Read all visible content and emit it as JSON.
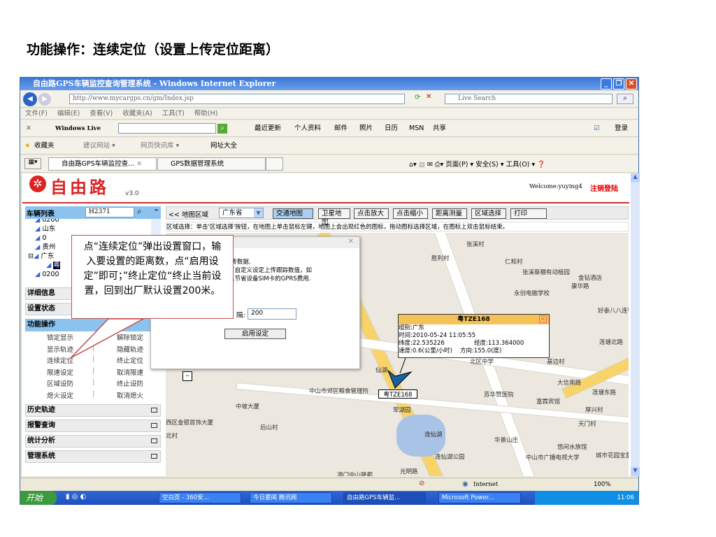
{
  "slide": {
    "title": "功能操作：连续定位（设置上传定位距离）"
  },
  "window": {
    "title": "自由路GPS车辆监控查询管理系统 - Windows Internet Explorer",
    "url": "http://www.mycargps.cn/gm/Index.jsp",
    "search_placeholder": "Live Search"
  },
  "menu": [
    "文件(F)",
    "编辑(E)",
    "查看(V)",
    "收藏夹(A)",
    "工具(T)",
    "帮助(H)"
  ],
  "live_toolbar": {
    "brand": "Windows Live",
    "links": [
      "最近更新",
      "个人资料",
      "邮件",
      "照片",
      "日历",
      "MSN",
      "共享"
    ],
    "signin": "登录"
  },
  "favorites": {
    "label": "收藏夹",
    "items": [
      "建议网站 ▾",
      "网页快讯库 ▾",
      "网址大全"
    ]
  },
  "tabs": [
    {
      "label": "自由路GPS车辆监控查..."
    },
    {
      "label": "GPS数据管理系统"
    }
  ],
  "command_bar": [
    "页面(P) ▾",
    "安全(S) ▾",
    "工具(O) ▾"
  ],
  "page": {
    "logo": "自由路",
    "version": "v3.0",
    "welcome": "Welcome:yuying4",
    "logout": "注销登陆"
  },
  "sidebar": {
    "vehicle_list": "车辆列表",
    "search_value": "H2371",
    "tree": [
      "0200",
      "山东",
      "0",
      "贵州",
      "广东",
      "粤",
      "0200"
    ],
    "sections": [
      "详细信息",
      "设置状态",
      "功能操作"
    ],
    "functions": [
      [
        "锁定显示",
        "解除锁定"
      ],
      [
        "显示轨迹",
        "隐藏轨迹"
      ],
      [
        "连续定位",
        "终止定位"
      ],
      [
        "限速设定",
        "取消限速"
      ],
      [
        "区域设防",
        "终止设防"
      ],
      [
        "熄火设定",
        "取消熄火"
      ]
    ],
    "collapsed": [
      "历史轨迹",
      "报警查询",
      "统计分析",
      "管理系统"
    ]
  },
  "map_toolbar": {
    "region_label": "<< 地图区域",
    "province": "广东省",
    "buttons": [
      "交通地图",
      "卫星地图",
      "点击放大",
      "点击缩小",
      "距离测量",
      "区域选择",
      "打印"
    ]
  },
  "hint": "区域选择：单击'区域选择'按钮，在地图上单击鼠标左键，地图上会出现红色的图标，拖动图标选择区域，在图标上双击鼠标结束。",
  "dialog": {
    "line1": "米)回传数据.",
    "line2": "后，可自定义设定上传跟踪数值，如",
    "line3": "位，以节省设备SIM卡的GPRS费用.",
    "field_label": "隔:",
    "field_value": "200",
    "button": "启用设定"
  },
  "callout": "点“连续定位”弹出设置窗口，输入要设置的距离数，点“启用设定”即可；”终止定位“终止当前设置，回到出厂默认设置200米。",
  "popup": {
    "title": "粤TZE168",
    "group": "组别:广东",
    "time": "时间:2010-05-24 11:05:55",
    "lat": "纬度:22.535226",
    "lng": "经度:113.364000",
    "speed": "速度:0.6(公里/小时)",
    "heading": "方向:155.0(度)"
  },
  "marker_label": "粤TZE168",
  "map_labels": [
    "胜利村",
    "张溪村",
    "仁和村",
    "张溪蔡棚有动植园",
    "永创电脑学校",
    "康华路",
    "好泰八八连锁酒店",
    "金钻酒店",
    "基边村",
    "北区中学",
    "莲塘北路",
    "大信南路",
    "莲塘东路",
    "中山市郊区粮食管理所",
    "苏华赞医院",
    "富霖宾馆",
    "厚兴村",
    "天门村",
    "中坡大厦",
    "后山村",
    "华景山庄",
    "逸仙湖",
    "逸仙湖公园",
    "悠闲水族馆",
    "中山市广播电视大学",
    "城市花园宝富阁",
    "西区金银首饰大厦",
    "北村",
    "光明路",
    "澳门中山隆都",
    "翠湖园",
    "仙湖"
  ],
  "status": {
    "zone": "Internet",
    "zoom": "100%"
  },
  "taskbar": {
    "start": "开始",
    "tasks": [
      "空白页 - 360安...",
      "今日要闻 腾讯网",
      "自由路GPS车辆监...",
      "Microsoft Power..."
    ],
    "clock": "11:06"
  }
}
